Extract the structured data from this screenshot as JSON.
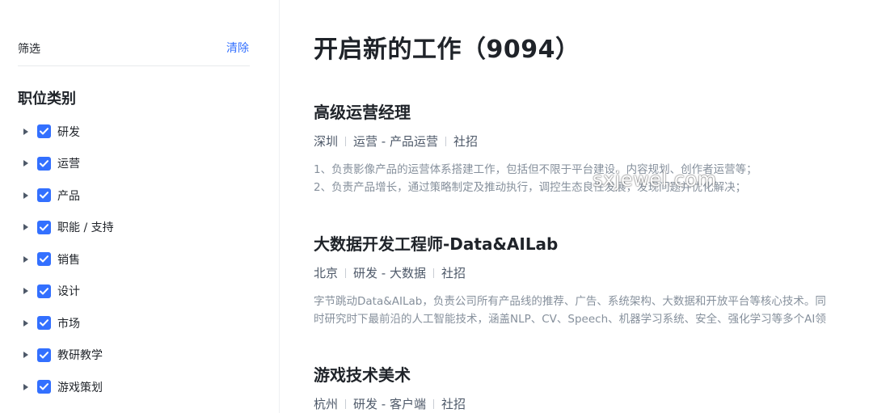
{
  "sidebar": {
    "filter_title": "筛选",
    "clear_label": "清除",
    "section_title": "职位类别",
    "categories": [
      {
        "label": "研发",
        "checked": true
      },
      {
        "label": "运营",
        "checked": true
      },
      {
        "label": "产品",
        "checked": true
      },
      {
        "label": "职能 / 支持",
        "checked": true
      },
      {
        "label": "销售",
        "checked": true
      },
      {
        "label": "设计",
        "checked": true
      },
      {
        "label": "市场",
        "checked": true
      },
      {
        "label": "教研教学",
        "checked": true
      },
      {
        "label": "游戏策划",
        "checked": true
      }
    ]
  },
  "main": {
    "title": "开启新的工作（9094）",
    "jobs": [
      {
        "title": "高级运营经理",
        "location": "深圳",
        "category": "运营 - 产品运营",
        "type": "社招",
        "desc": [
          "1、负责影像产品的运营体系搭建工作，包括但不限于平台建设、内容规划、创作者运营等；",
          "2、负责产品增长，通过策略制定及推动执行，调控生态良性发展，发现问题并优化解决；"
        ]
      },
      {
        "title": "大数据开发工程师-Data&AILab",
        "location": "北京",
        "category": "研发 - 大数据",
        "type": "社招",
        "desc": [
          "字节跳动Data&AILab，负责公司所有产品线的推荐、广告、系统架构、大数据和开放平台等核心技术。同",
          "时研究时下最前沿的人工智能技术，涵盖NLP、CV、Speech、机器学习系统、安全、强化学习等多个AI领"
        ]
      },
      {
        "title": "游戏技术美术",
        "location": "杭州",
        "category": "研发 - 客户端",
        "type": "社招",
        "desc": []
      }
    ]
  },
  "watermark": "sxjewel.com",
  "colors": {
    "accent": "#3370ff",
    "text": "#1f2329",
    "meta": "#4e5969",
    "desc": "#86909c"
  }
}
